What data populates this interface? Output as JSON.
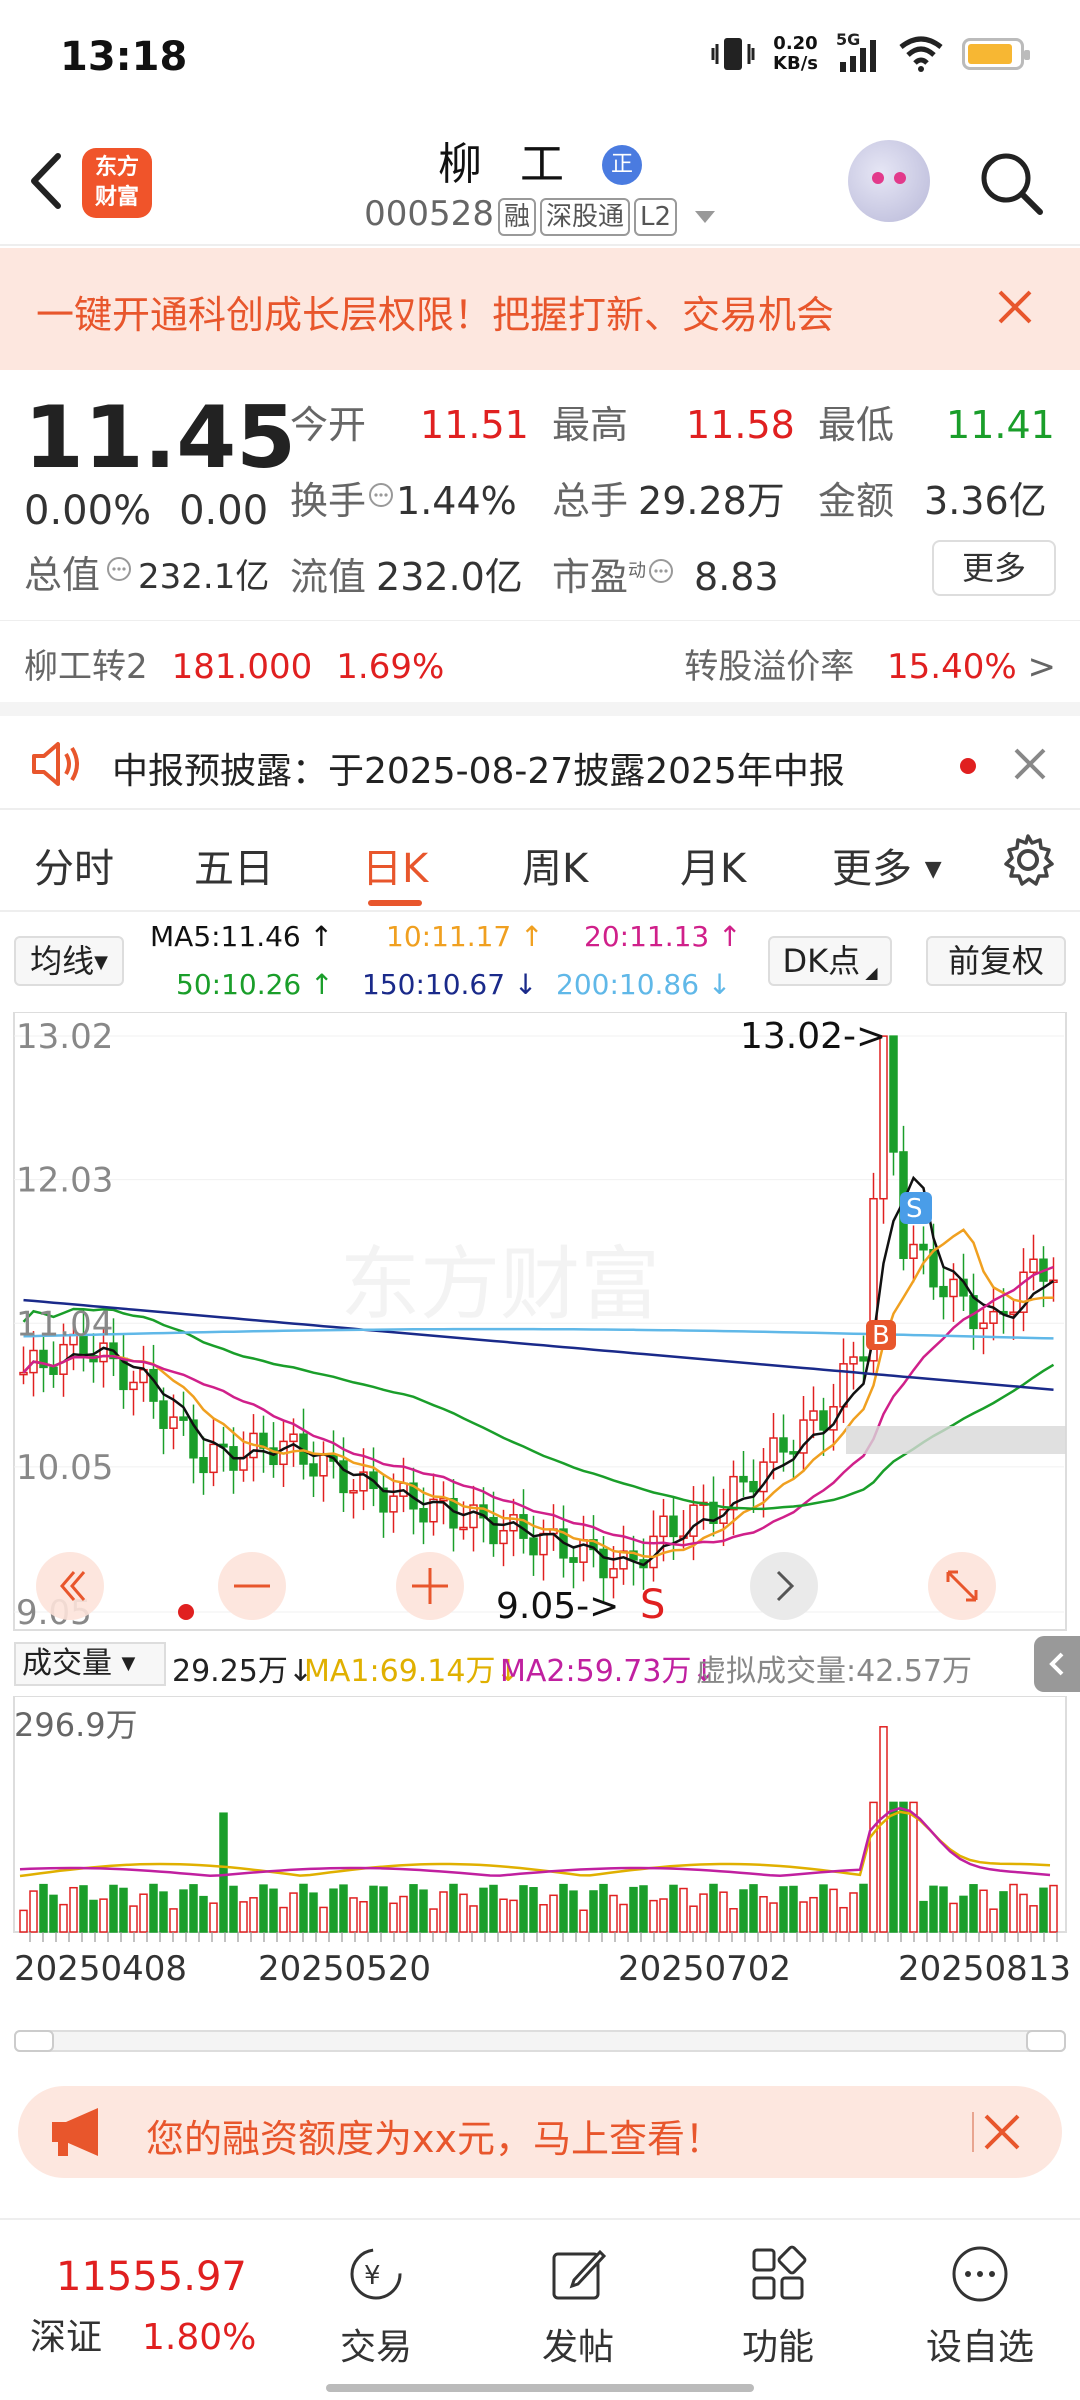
{
  "status_bar": {
    "time": "13:18",
    "net_speed": "0.20",
    "net_unit": "KB/s",
    "network": "5G"
  },
  "header": {
    "logo_line1": "东方",
    "logo_line2": "财富",
    "stock_name": "柳 工",
    "badge": "正",
    "stock_code": "000528",
    "tags": [
      "融",
      "深股通",
      "L2"
    ]
  },
  "banner": {
    "text": "一键开通科创成长层权限！把握打新、交易机会"
  },
  "quote": {
    "price": "11.45",
    "change_pct": "0.00%",
    "change_amt": "0.00",
    "total_value_label": "总值",
    "total_value": "232.1亿",
    "open_label": "今开",
    "open": "11.51",
    "high_label": "最高",
    "high": "11.58",
    "low_label": "最低",
    "low": "11.41",
    "turnover_label": "换手",
    "turnover": "1.44%",
    "volume_label": "总手",
    "volume": "29.28万",
    "amount_label": "金额",
    "amount": "3.36亿",
    "float_label": "流值",
    "float_value": "232.0亿",
    "pe_label": "市盈",
    "pe_sup": "动",
    "pe": "8.83",
    "more": "更多"
  },
  "convertible": {
    "name": "柳工转2",
    "price": "181.000",
    "pct": "1.69%",
    "premium_label": "转股溢价率",
    "premium": "15.40%"
  },
  "notice": {
    "text": "中报预披露：于2025-08-27披露2025年中报"
  },
  "tabs": [
    "分时",
    "五日",
    "日K",
    "周K",
    "月K",
    "更多"
  ],
  "active_tab": 2,
  "ma_legend": {
    "selector": "均线",
    "ma5": "MA5:11.46 ↑",
    "ma10": "10:11.17 ↑",
    "ma20": "20:11.13 ↑",
    "ma50": "50:10.26 ↑",
    "ma150": "150:10.67 ↓",
    "ma200": "200:10.86 ↓",
    "dk": "DK点",
    "fq": "前复权",
    "colors": {
      "ma5": "#111111",
      "ma10": "#f0a020",
      "ma20": "#d0208a",
      "ma50": "#1a9e2a",
      "ma150": "#1a2a8a",
      "ma200": "#60b8e8"
    }
  },
  "kchart": {
    "y_ticks": [
      "13.02",
      "12.03",
      "11.04",
      "10.05",
      "9.05"
    ],
    "high_marker": "13.02->",
    "low_marker": "9.05->",
    "buy_label": "B",
    "sell_label": "S",
    "sell_label2": "S",
    "watermark": "东方财富"
  },
  "volume": {
    "selector": "成交量",
    "value": "29.25万↓",
    "ma1": "MA1:69.14万↓",
    "ma2": "MA2:59.73万↓",
    "virtual": "虚拟成交量:42.57万",
    "max_label": "296.9万"
  },
  "x_dates": [
    "20250408",
    "20250520",
    "20250702",
    "20250813"
  ],
  "promo": {
    "text": "您的融资额度为xx元，马上查看！"
  },
  "bottom_nav": {
    "index_value": "11555.97",
    "index_name": "深证",
    "index_pct": "1.80%",
    "items": [
      "交易",
      "发帖",
      "功能",
      "设自选"
    ]
  },
  "chart_data": {
    "type": "candlestick",
    "title": "",
    "x_range": [
      "20250408",
      "20250813"
    ],
    "ylim": [
      9.05,
      13.02
    ],
    "high": 13.02,
    "low": 9.05,
    "last_close": 11.45,
    "moving_averages": [
      {
        "name": "MA5",
        "value": 11.46
      },
      {
        "name": "MA10",
        "value": 11.17
      },
      {
        "name": "MA20",
        "value": 11.13
      },
      {
        "name": "MA50",
        "value": 10.26
      },
      {
        "name": "MA150",
        "value": 10.67
      },
      {
        "name": "MA200",
        "value": 10.86
      }
    ],
    "volume_max": "296.9万"
  }
}
